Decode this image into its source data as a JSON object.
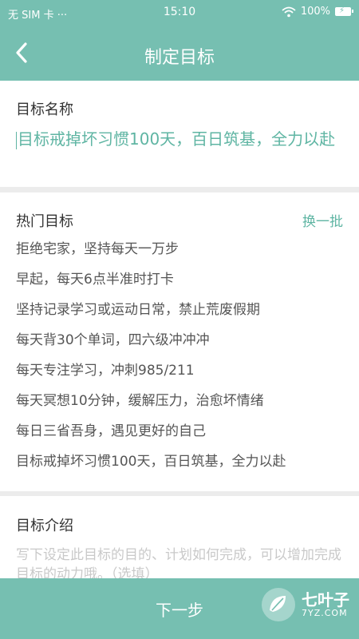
{
  "status_bar": {
    "carrier": "无 SIM 卡 ···",
    "time": "15:10",
    "battery": "100%"
  },
  "header": {
    "title": "制定目标"
  },
  "goal_name": {
    "label": "目标名称",
    "value": "目标戒掉坏习惯100天，百日筑基，全力以赴"
  },
  "hot_goals": {
    "label": "热门目标",
    "refresh_label": "换一批",
    "items": [
      "拒绝宅家，坚持每天一万步",
      "早起，每天6点半准时打卡",
      "坚持记录学习或运动日常，禁止荒废假期",
      "每天背30个单词，四六级冲冲冲",
      "每天专注学习，冲刺985/211",
      "每天冥想10分钟，缓解压力，治愈坏情绪",
      "每日三省吾身，遇见更好的自己",
      "目标戒掉坏习惯100天，百日筑基，全力以赴"
    ]
  },
  "goal_intro": {
    "label": "目标介绍",
    "placeholder": "写下设定此目标的目的、计划如何完成，可以增加完成目标的动力哦。（选填）"
  },
  "footer": {
    "next_label": "下一步",
    "watermark_brand": "七叶子",
    "watermark_site": "7YZ.COM"
  },
  "colors": {
    "accent": "#76bfb1",
    "accent_text": "#5fb5a3"
  }
}
